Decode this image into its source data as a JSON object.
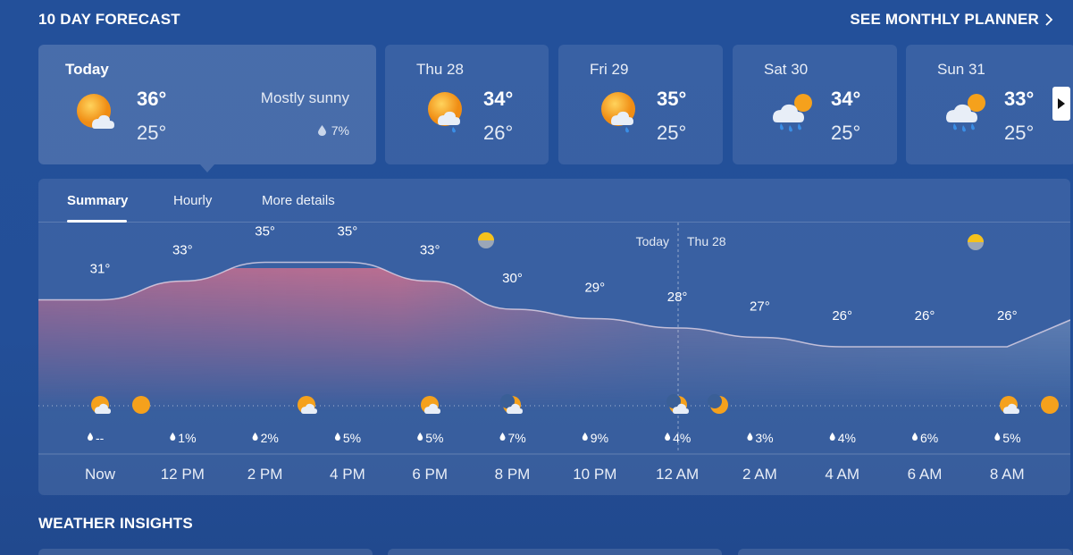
{
  "header": {
    "title": "10 DAY FORECAST",
    "monthly_link": "SEE MONTHLY PLANNER"
  },
  "days": [
    {
      "label": "Today",
      "high": "36°",
      "low": "25°",
      "condition": "Mostly sunny",
      "precip": "7%",
      "icon": "sun-cloud-icon"
    },
    {
      "label": "Thu 28",
      "high": "34°",
      "low": "26°",
      "icon": "sun-cloud-rain-icon"
    },
    {
      "label": "Fri 29",
      "high": "35°",
      "low": "25°",
      "icon": "sun-cloud-rain-icon"
    },
    {
      "label": "Sat 30",
      "high": "34°",
      "low": "25°",
      "icon": "rain-showers-icon"
    },
    {
      "label": "Sun 31",
      "high": "33°",
      "low": "25°",
      "icon": "rain-showers-icon"
    }
  ],
  "tabs": [
    "Summary",
    "Hourly",
    "More details"
  ],
  "active_tab": "Summary",
  "hourly": {
    "today_marker": "Today",
    "next_day_marker": "Thu 28",
    "temps": [
      "31°",
      "33°",
      "35°",
      "35°",
      "33°",
      "30°",
      "29°",
      "28°",
      "27°",
      "26°",
      "26°",
      "26°"
    ],
    "precip": [
      "--",
      "1%",
      "2%",
      "5%",
      "5%",
      "7%",
      "9%",
      "4%",
      "3%",
      "4%",
      "6%",
      "5%"
    ],
    "times": [
      "Now",
      "12 PM",
      "2 PM",
      "4 PM",
      "6 PM",
      "8 PM",
      "10 PM",
      "12 AM",
      "2 AM",
      "4 AM",
      "6 AM",
      "8 AM"
    ]
  },
  "chart_data": {
    "type": "area",
    "x": [
      "Now",
      "12 PM",
      "2 PM",
      "4 PM",
      "6 PM",
      "8 PM",
      "10 PM",
      "12 AM",
      "2 AM",
      "4 AM",
      "6 AM",
      "8 AM"
    ],
    "series": [
      {
        "values": [
          31,
          33,
          35,
          35,
          33,
          30,
          29,
          28,
          27,
          26,
          26,
          26
        ]
      }
    ],
    "precipitation_percent": [
      null,
      1,
      2,
      5,
      5,
      7,
      9,
      4,
      3,
      4,
      6,
      5
    ]
  },
  "insights": {
    "title": "WEATHER INSIGHTS"
  },
  "colors": {
    "background": "#23509a",
    "sun": "#f7a21b",
    "curve_warm": "#d9728f",
    "curve_cool": "#8aa6c8"
  }
}
